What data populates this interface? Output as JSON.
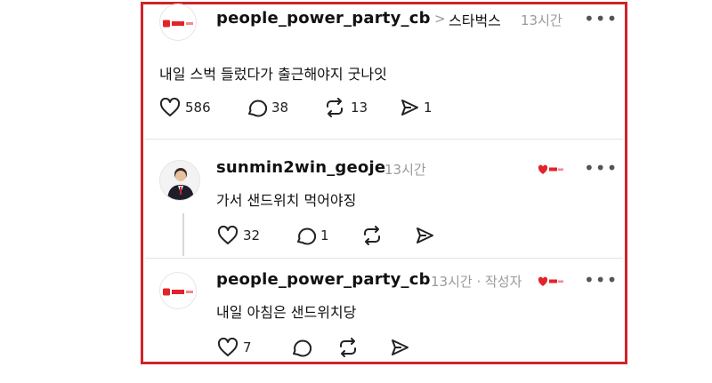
{
  "post": {
    "username": "people_power_party_cb",
    "separator": ">",
    "topic": "스타벅스",
    "time": "13시간",
    "more": "•••",
    "text": "내일 스벅 들렀다가 출근해야지 굿나잇",
    "likes": "586",
    "replies": "38",
    "reposts": "13",
    "shares": "1"
  },
  "reply1": {
    "username": "sunmin2win_geoje",
    "time": "13시간",
    "more": "•••",
    "text": "가서 샌드위치 먹어야징",
    "likes": "32",
    "replies": "1"
  },
  "reply2": {
    "username": "people_power_party_cb",
    "time": "13시간 · 작성자",
    "more": "•••",
    "text": "내일 아침은 샌드위치당",
    "likes": "7"
  },
  "colors": {
    "frame": "#d0232a",
    "brand": "#e2232a",
    "muted": "#9a9a9a"
  },
  "icons": [
    "heart-icon",
    "comment-icon",
    "repost-icon",
    "share-icon",
    "more-icon"
  ]
}
